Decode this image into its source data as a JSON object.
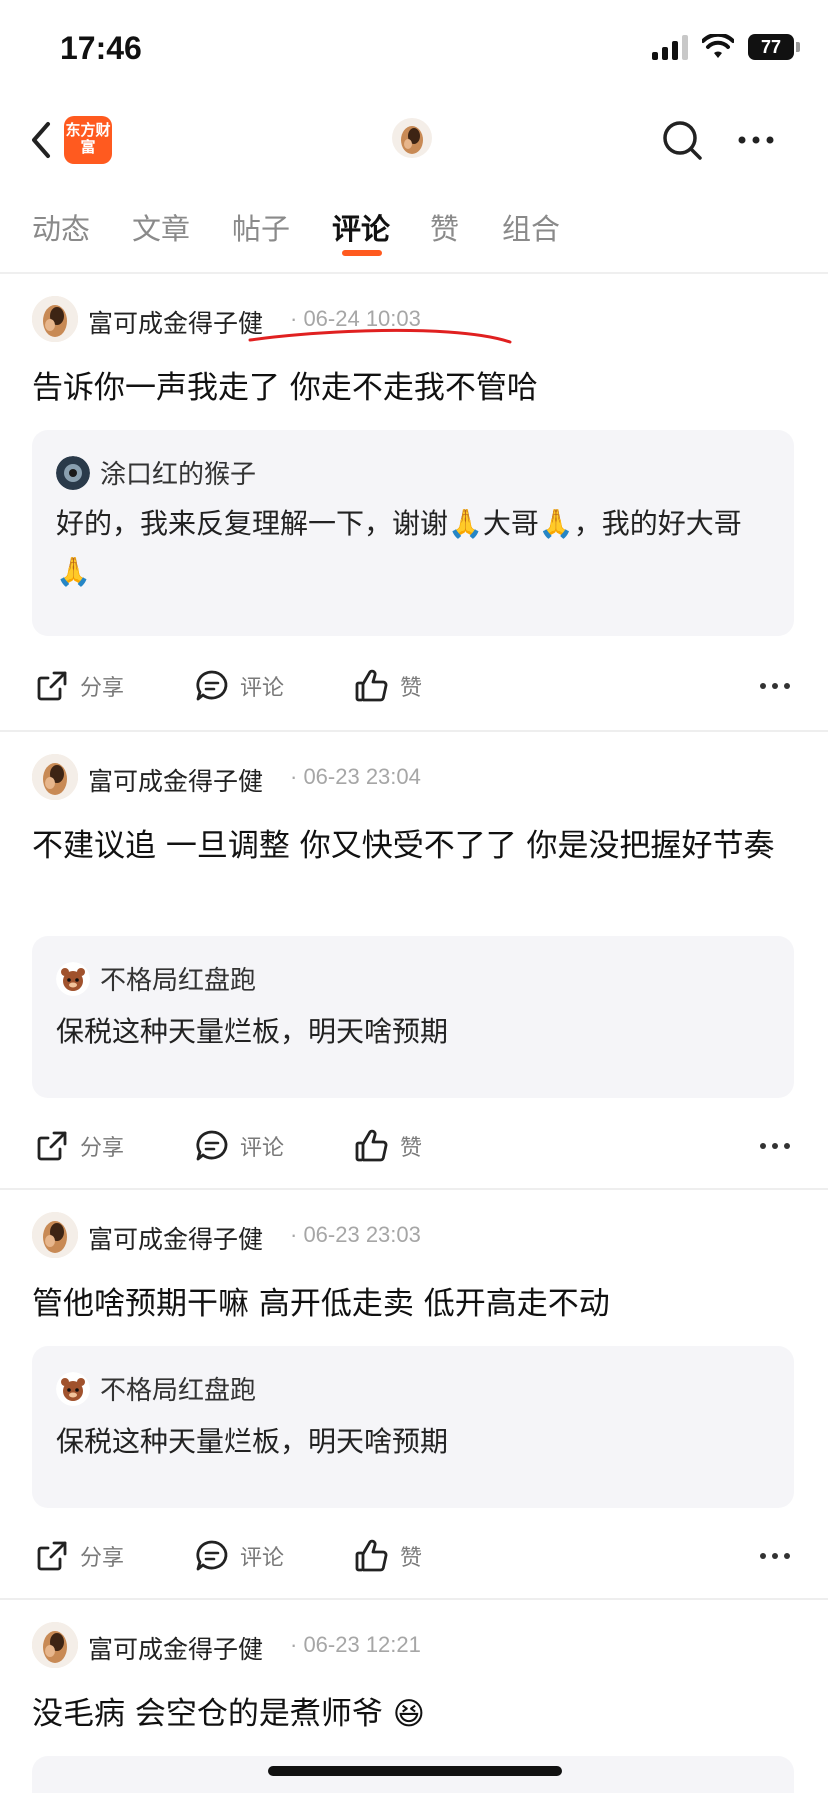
{
  "status_bar": {
    "time": "17:46",
    "battery": "77"
  },
  "tabs": [
    {
      "label": "动态"
    },
    {
      "label": "文章"
    },
    {
      "label": "帖子"
    },
    {
      "label": "评论",
      "active": true
    },
    {
      "label": "赞"
    },
    {
      "label": "组合"
    }
  ],
  "brand": {
    "logo_text": "东方财富"
  },
  "actions": {
    "share": "分享",
    "comment": "评论",
    "like": "赞"
  },
  "posts": [
    {
      "author": "富可成金得子健",
      "meta": "· 06-24 10:03",
      "text": "告诉你一声我走了 你走不走我不管哈",
      "quote": {
        "author": "涂口红的猴子",
        "text": "好的，我来反复理解一下，谢谢🙏大哥🙏，我的好大哥🙏"
      }
    },
    {
      "author": "富可成金得子健",
      "meta": "· 06-23 23:04",
      "text": "不建议追 一旦调整 你又快受不了了 你是没把握好节奏",
      "quote": {
        "author": "不格局红盘跑",
        "text": "保税这种天量烂板，明天啥预期"
      }
    },
    {
      "author": "富可成金得子健",
      "meta": "· 06-23 23:03",
      "text": "管他啥预期干嘛 高开低走卖 低开高走不动",
      "quote": {
        "author": "不格局红盘跑",
        "text": "保税这种天量烂板，明天啥预期"
      }
    },
    {
      "author": "富可成金得子健",
      "meta": "· 06-23 12:21",
      "text": "没毛病 会空仓的是煮师爷 😆"
    }
  ]
}
